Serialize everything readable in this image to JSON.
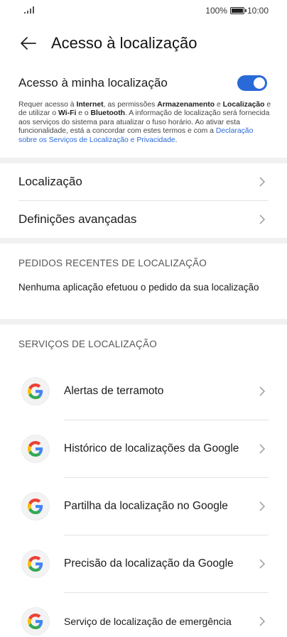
{
  "status_bar": {
    "signal_icon": "signal-icon",
    "battery_text": "100%",
    "battery_level": 1.0,
    "time": "10:00"
  },
  "app_bar": {
    "back_icon": "arrow-left-icon",
    "title": "Acesso à localização"
  },
  "toggle": {
    "label": "Acesso à minha localização",
    "on": true,
    "color": "#2a6ad8"
  },
  "description": {
    "p1": "Requer acesso à ",
    "b1": "Internet",
    "p2": ", as permissões ",
    "b2": "Armazenamento",
    "p3": " e ",
    "b3": "Localização",
    "p4": " e de utilizar o ",
    "b4": "Wi-Fi",
    "p5": " e o ",
    "b5": "Bluetooth",
    "p6": ". A informação de localização será fornecida aos serviços do sistema para atualizar o fuso horário. Ao ativar esta funcionalidade, está a concordar com estes termos e com a ",
    "link": "Declaração sobre os Serviços de Localização e Privacidade",
    "p7": "."
  },
  "nav": [
    {
      "label": "Localização"
    },
    {
      "label": "Definições avançadas"
    }
  ],
  "recent": {
    "heading": "PEDIDOS RECENTES DE LOCALIZAÇÃO",
    "text": "Nenhuma aplicação efetuou o pedido da sua localização"
  },
  "services": {
    "heading": "SERVIÇOS DE LOCALIZAÇÃO",
    "items": [
      {
        "label": "Alertas de terramoto",
        "icon": "google-icon"
      },
      {
        "label": "Histórico de localizações da Google",
        "icon": "google-icon"
      },
      {
        "label": "Partilha da localização no Google",
        "icon": "google-icon"
      },
      {
        "label": "Precisão da localização da Google",
        "icon": "google-icon"
      },
      {
        "label": "Serviço de localização de emergência",
        "icon": "google-icon"
      }
    ]
  },
  "colors": {
    "accent": "#2a6ad8",
    "google_blue": "#4285F4",
    "google_red": "#EA4335",
    "google_yellow": "#FBBC05",
    "google_green": "#34A853"
  }
}
